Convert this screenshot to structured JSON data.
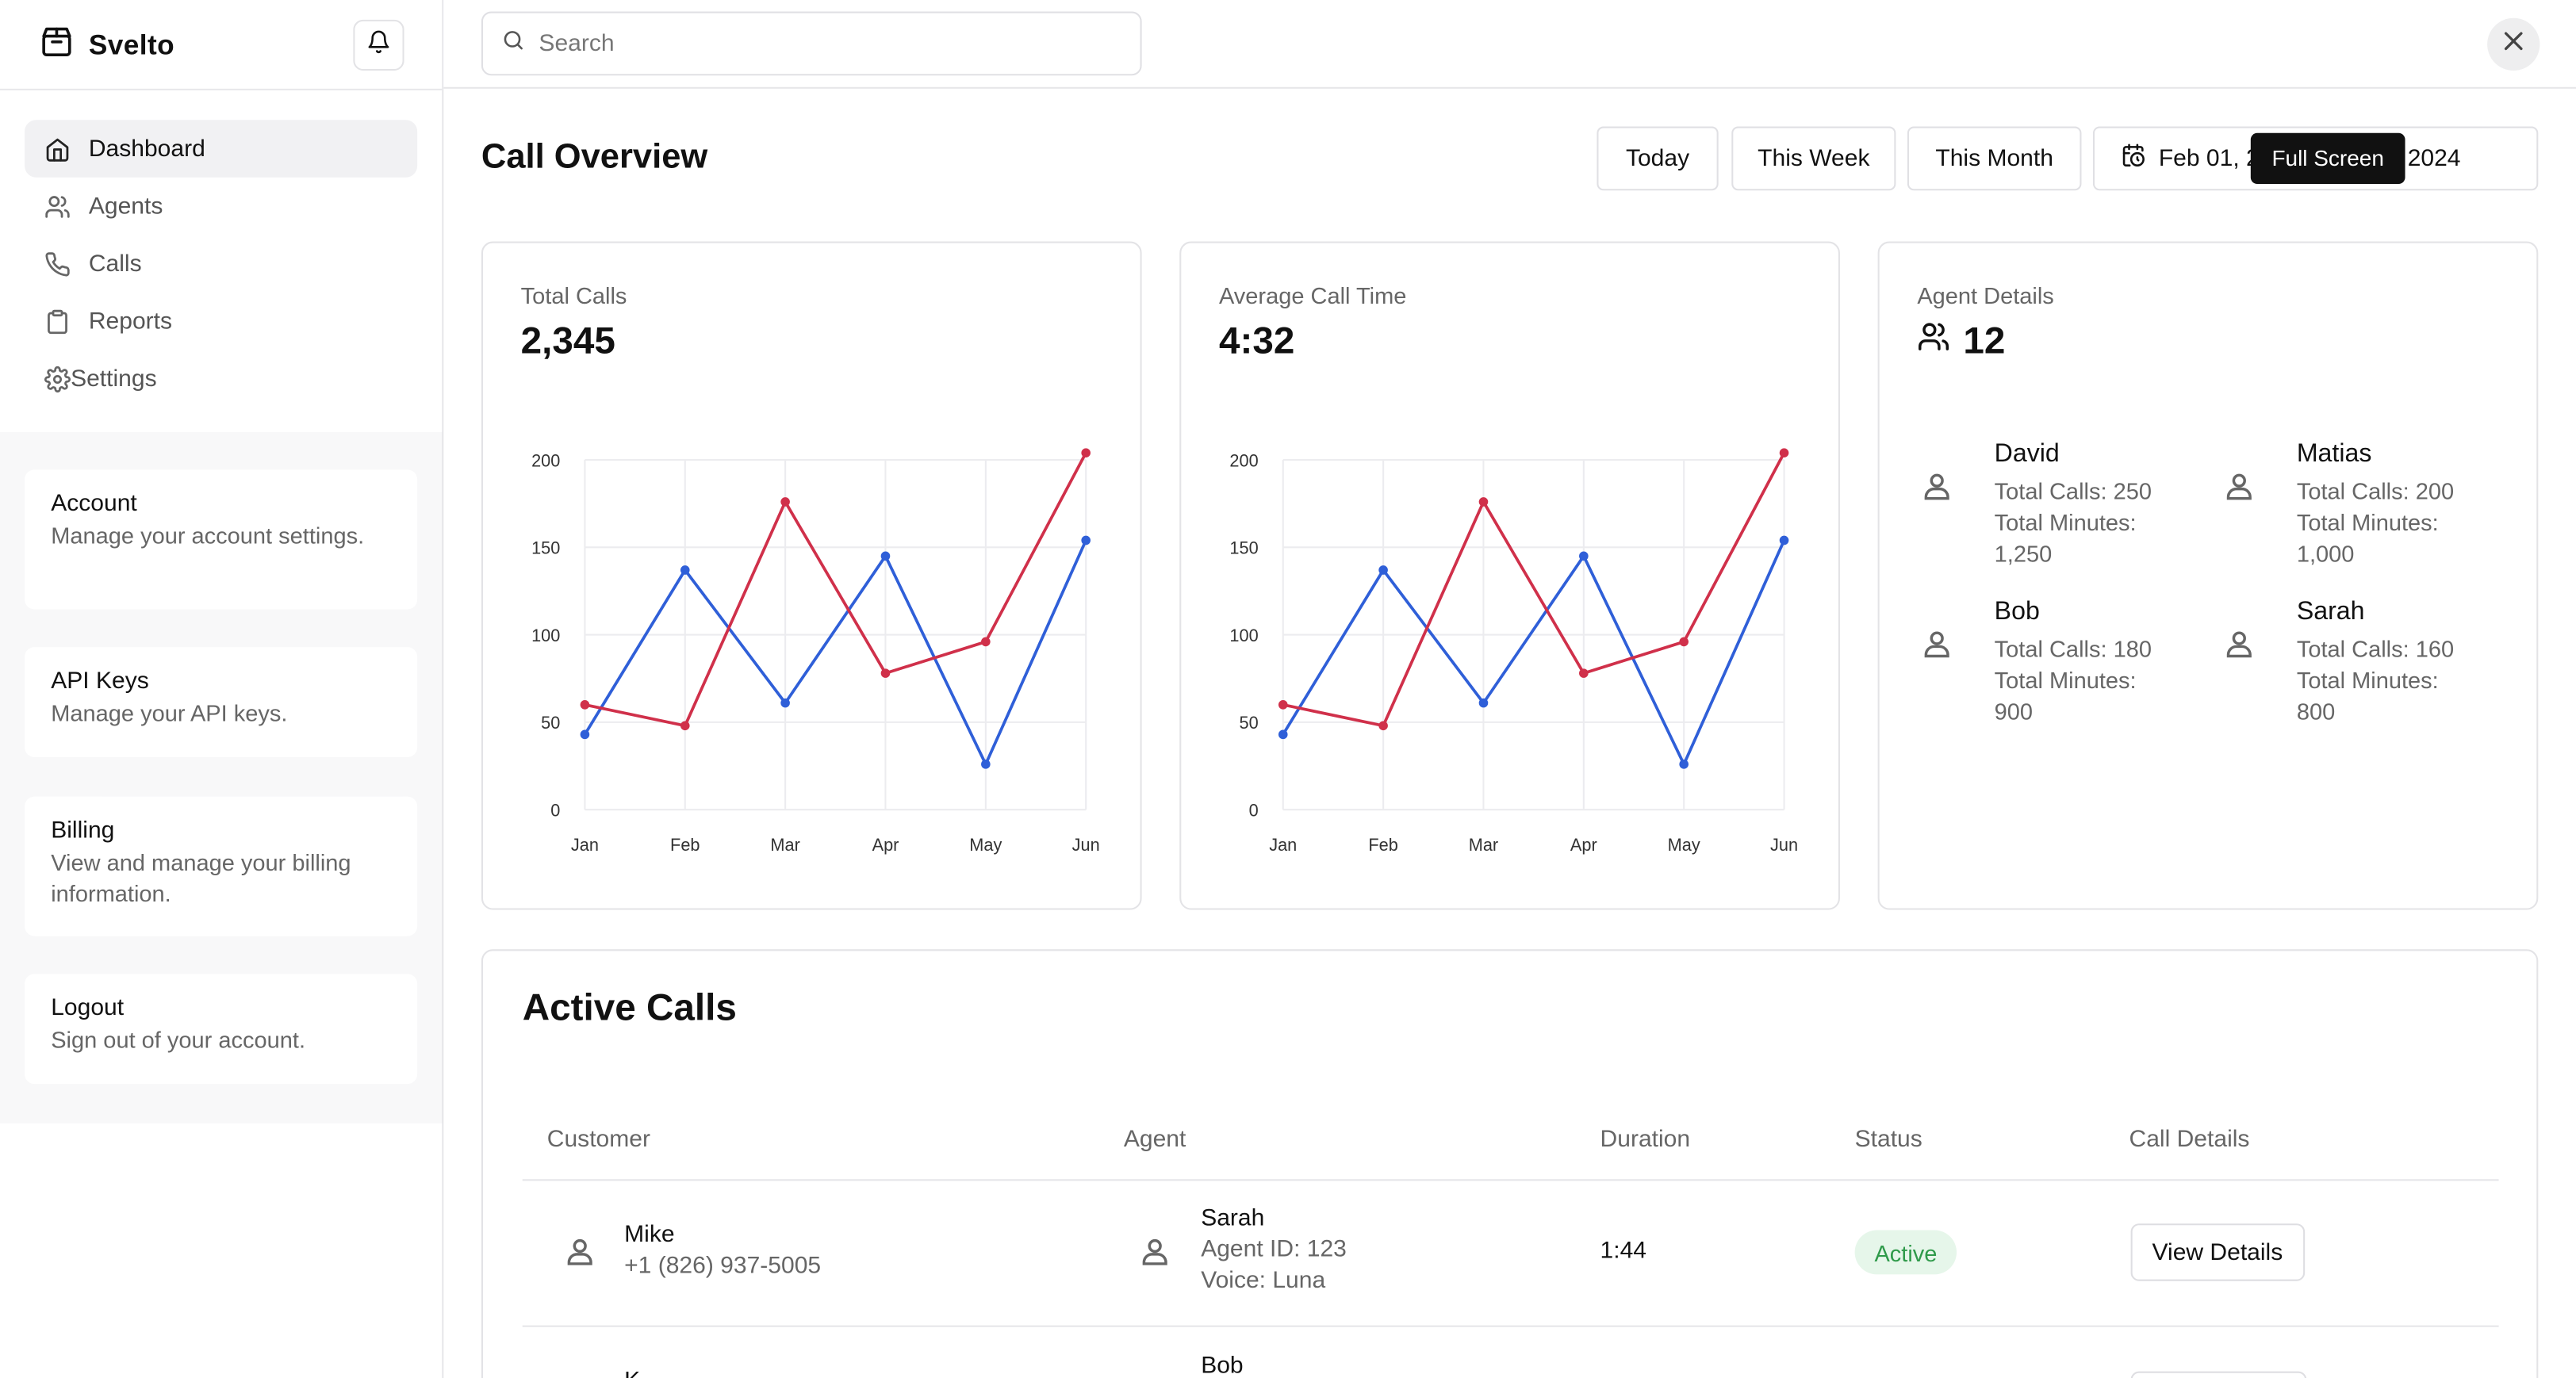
{
  "brand": {
    "name": "Svelto"
  },
  "search": {
    "placeholder": "Search"
  },
  "nav": [
    {
      "label": "Dashboard",
      "icon": "home-icon",
      "active": true
    },
    {
      "label": "Agents",
      "icon": "users-icon"
    },
    {
      "label": "Calls",
      "icon": "phone-icon"
    },
    {
      "label": "Reports",
      "icon": "clipboard-icon"
    },
    {
      "label": "Settings",
      "icon": "gear-icon"
    }
  ],
  "sidebar_cards": [
    {
      "title": "Account",
      "desc": "Manage your account settings."
    },
    {
      "title": "API Keys",
      "desc": "Manage your API keys."
    },
    {
      "title": "Billing",
      "desc": "View and manage your billing information."
    },
    {
      "title": "Logout",
      "desc": "Sign out of your account."
    }
  ],
  "page_title": "Call Overview",
  "filters": {
    "today": "Today",
    "week": "This Week",
    "month": "This Month",
    "date_range": "Feb 01, 2024 - Mar 01, 2024"
  },
  "tooltip": "Full Screen",
  "stats": {
    "total_calls": {
      "label": "Total Calls",
      "value": "2,345"
    },
    "avg_call_time": {
      "label": "Average Call Time",
      "value": "4:32"
    },
    "agent_details": {
      "label": "Agent Details",
      "value": "12"
    }
  },
  "agents": [
    {
      "name": "David",
      "calls": "Total Calls: 250",
      "minutes": "Total Minutes:",
      "minutes_val": "1,250"
    },
    {
      "name": "Matias",
      "calls": "Total Calls: 200",
      "minutes": "Total Minutes:",
      "minutes_val": "1,000"
    },
    {
      "name": "Bob",
      "calls": "Total Calls: 180",
      "minutes": "Total Minutes:",
      "minutes_val": "900"
    },
    {
      "name": "Sarah",
      "calls": "Total Calls: 160",
      "minutes": "Total Minutes:",
      "minutes_val": "800"
    }
  ],
  "colors": {
    "series_blue": "#2f5fd8",
    "series_red": "#d0304a",
    "status_active_bg": "#e6f6ea",
    "status_active_text": "#2f9a4a"
  },
  "chart_data": [
    {
      "type": "line",
      "categories": [
        "Jan",
        "Feb",
        "Mar",
        "Apr",
        "May",
        "Jun"
      ],
      "series": [
        {
          "values": [
            43,
            137,
            61,
            145,
            26,
            154
          ]
        },
        {
          "values": [
            60,
            48,
            176,
            78,
            96,
            204
          ]
        }
      ],
      "ylim": [
        0,
        200
      ],
      "yticks": [
        0,
        50,
        100,
        150,
        200
      ],
      "grid": true
    },
    {
      "type": "line",
      "categories": [
        "Jan",
        "Feb",
        "Mar",
        "Apr",
        "May",
        "Jun"
      ],
      "series": [
        {
          "values": [
            43,
            137,
            61,
            145,
            26,
            154
          ]
        },
        {
          "values": [
            60,
            48,
            176,
            78,
            96,
            204
          ]
        }
      ],
      "ylim": [
        0,
        200
      ],
      "yticks": [
        0,
        50,
        100,
        150,
        200
      ],
      "grid": true
    }
  ],
  "active_calls": {
    "title": "Active Calls",
    "headers": [
      "Customer",
      "Agent",
      "Duration",
      "Status",
      "Call Details"
    ],
    "rows": [
      {
        "customer": "Mike",
        "phone": "+1 (826) 937-5005",
        "agent": "Sarah",
        "agent_id": "Agent ID: 123",
        "voice": "Voice: Luna",
        "duration": "1:44",
        "status": "Active",
        "action": "View Details"
      },
      {
        "customer": "K",
        "phone": "",
        "agent": "Bob",
        "agent_id": "",
        "voice": "",
        "duration": "",
        "status": "",
        "action": ""
      }
    ]
  }
}
